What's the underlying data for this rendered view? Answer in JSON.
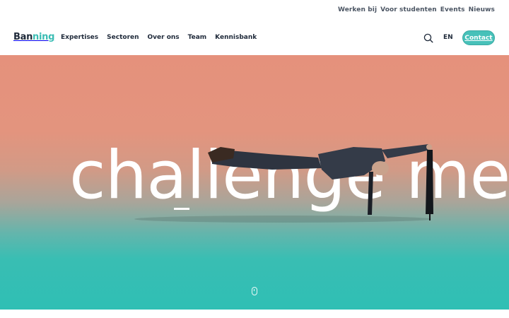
{
  "header": {
    "logo": {
      "part1": "Ban",
      "part2": "ning"
    },
    "top_links": [
      "Werken bij",
      "Voor studenten",
      "Events",
      "Nieuws"
    ],
    "main_links": [
      "Expertises",
      "Sectoren",
      "Over ons",
      "Team",
      "Kennisbank"
    ],
    "search_icon": "search-icon",
    "language": "EN",
    "contact_label": "Contact",
    "accent_color": "#47c1b9"
  },
  "hero": {
    "headline": "challenge me",
    "scroll_icon": "mouse-scroll-icon",
    "gradient_top": "#e5917c",
    "gradient_bottom": "#2fbfb4"
  }
}
